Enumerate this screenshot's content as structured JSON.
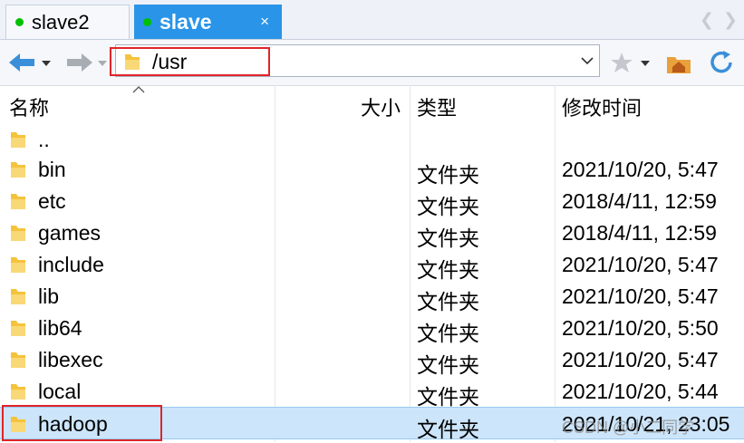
{
  "tabs": [
    {
      "label": "slave2",
      "active": false
    },
    {
      "label": "slave",
      "active": true
    }
  ],
  "tab_close_glyph": "×",
  "tab_nav": {
    "prev": "❮",
    "next": "❯"
  },
  "address": {
    "path": "/usr"
  },
  "columns": {
    "name": "名称",
    "size": "大小",
    "type": "类型",
    "modified": "修改时间"
  },
  "files": [
    {
      "name": "..",
      "type": "",
      "modified": ""
    },
    {
      "name": "bin",
      "type": "文件夹",
      "modified": "2021/10/20, 5:47"
    },
    {
      "name": "etc",
      "type": "文件夹",
      "modified": "2018/4/11, 12:59"
    },
    {
      "name": "games",
      "type": "文件夹",
      "modified": "2018/4/11, 12:59"
    },
    {
      "name": "include",
      "type": "文件夹",
      "modified": "2021/10/20, 5:47"
    },
    {
      "name": "lib",
      "type": "文件夹",
      "modified": "2021/10/20, 5:47"
    },
    {
      "name": "lib64",
      "type": "文件夹",
      "modified": "2021/10/20, 5:50"
    },
    {
      "name": "libexec",
      "type": "文件夹",
      "modified": "2021/10/20, 5:47"
    },
    {
      "name": "local",
      "type": "文件夹",
      "modified": "2021/10/20, 5:44"
    },
    {
      "name": "hadoop",
      "type": "文件夹",
      "modified": "2021/10/21, 23:05",
      "selected": true
    }
  ],
  "watermark": "CSDN @小二同学",
  "colors": {
    "accent": "#2a95e8",
    "selection": "#cce5fa",
    "highlight": "#e0242a",
    "folder": "#f5c33b"
  }
}
